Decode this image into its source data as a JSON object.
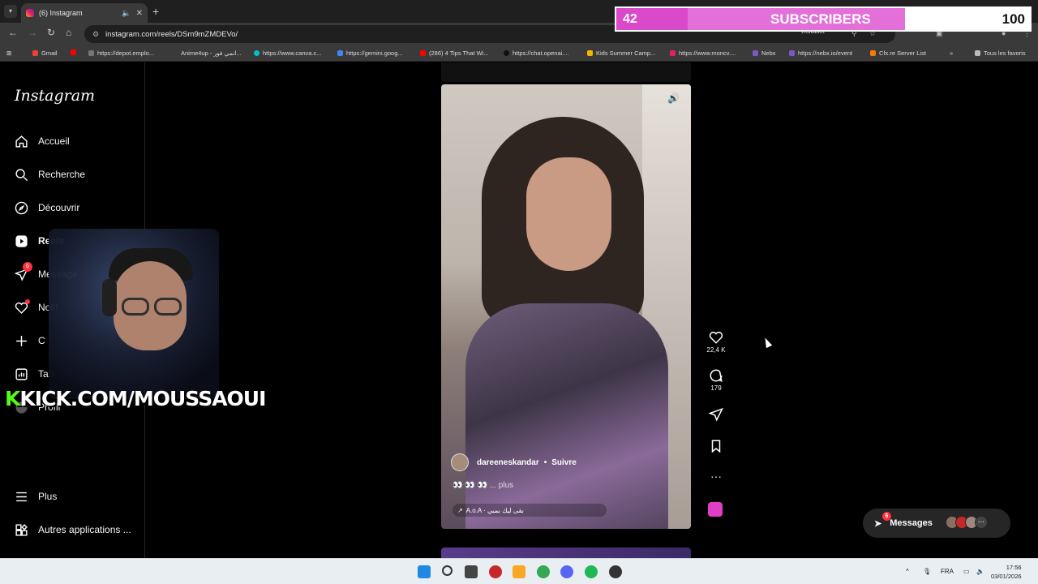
{
  "browser": {
    "tab_title": "(6) Instagram",
    "url": "instagram.com/reels/DSm9mZMDEVo/",
    "installer_label": "Installer",
    "bookmarks": [
      "Gmail",
      "https://depot.emplo...",
      "Anime4up - انمي فور...",
      "https://www.canva.c...",
      "https://gemini.goog...",
      "(286) 4 Tips That Wi...",
      "https://chat.openai....",
      "Kids Summer Camp...",
      "https://www.moncv....",
      "Nebx",
      "https://nebx.io/event",
      "Cfx.re Server List",
      "Tous les favoris"
    ]
  },
  "overlay": {
    "subs_current": "42",
    "subs_label": "SUBSCRIBERS",
    "subs_goal": "100",
    "subs_progress": 0.42,
    "kick_prefix": "K",
    "kick_text": "KICK.COM/MOUSSAOUI"
  },
  "sidebar": {
    "logo": "Instagram",
    "items": [
      {
        "label": "Accueil",
        "icon": "home-icon"
      },
      {
        "label": "Recherche",
        "icon": "search-icon"
      },
      {
        "label": "Découvrir",
        "icon": "compass-icon"
      },
      {
        "label": "Reels",
        "icon": "reels-icon"
      },
      {
        "label": "Message",
        "icon": "messenger-icon",
        "badge": "6"
      },
      {
        "label": "Notif",
        "icon": "heart-icon"
      },
      {
        "label": "C",
        "icon": "plus-icon"
      },
      {
        "label": "Tab",
        "icon": "dashboard-icon"
      },
      {
        "label": "Profil",
        "icon": "avatar-icon"
      }
    ],
    "more_label": "Plus",
    "apps_label": "Autres applications ..."
  },
  "reel": {
    "author": "dareeneskandar",
    "follow_label": "Suivre",
    "caption": "👀 👀 👀 ... plus",
    "music": "A.o.A · بقى ليك بمبي",
    "likes": "22,4 K",
    "comments": "179"
  },
  "messages": {
    "label": "Messages",
    "badge": "6"
  },
  "taskbar": {
    "lang": "FRA",
    "time": "17:56",
    "date": "03/01/2026"
  },
  "colors": {
    "instagram_bg": "#000000",
    "subscriber_bar": "#d949c9",
    "kick_green": "#53fc18",
    "notification_red": "#ff3040"
  }
}
